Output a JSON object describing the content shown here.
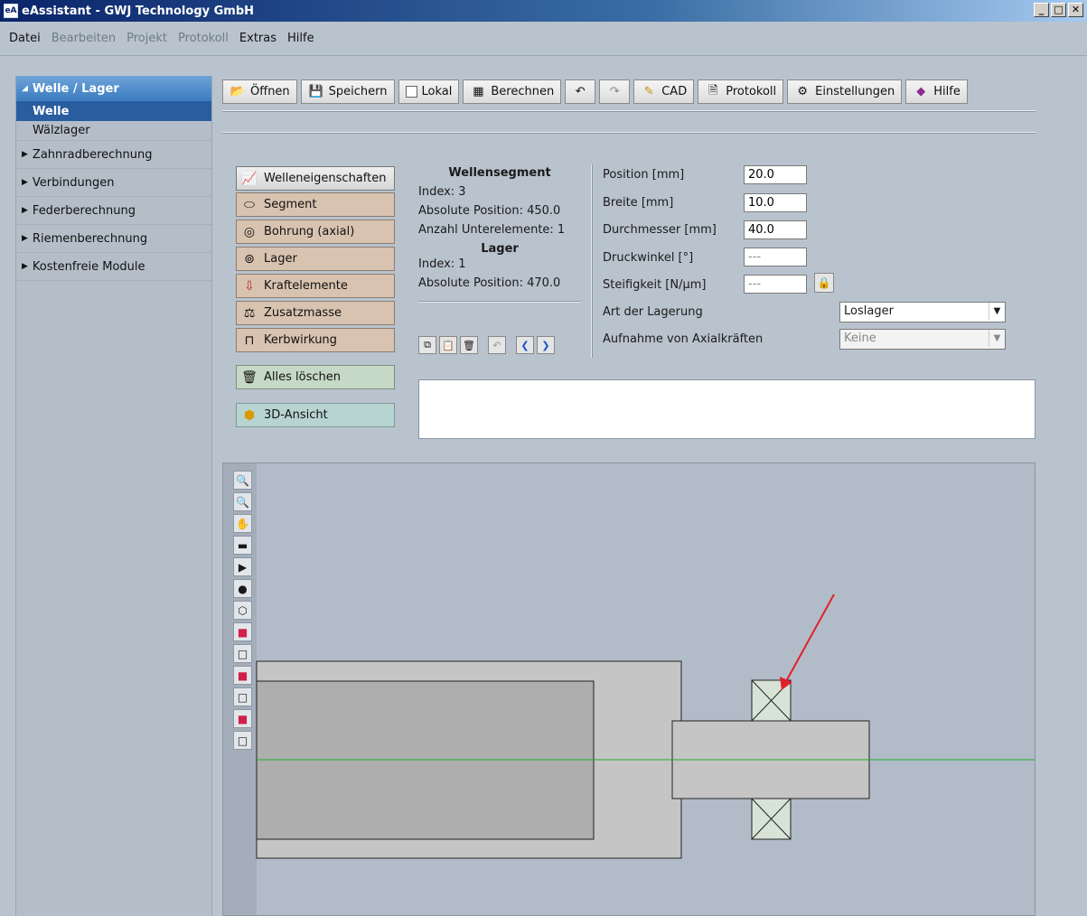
{
  "window": {
    "title": "eAssistant - GWJ Technology GmbH",
    "icon": "eA"
  },
  "menu": [
    {
      "label": "Datei",
      "enabled": true
    },
    {
      "label": "Bearbeiten",
      "enabled": false
    },
    {
      "label": "Projekt",
      "enabled": false
    },
    {
      "label": "Protokoll",
      "enabled": false
    },
    {
      "label": "Extras",
      "enabled": true
    },
    {
      "label": "Hilfe",
      "enabled": true
    }
  ],
  "sidebar": {
    "group": "Welle / Lager",
    "items": [
      "Welle",
      "Wälzlager"
    ],
    "active": "Welle",
    "collapsed": [
      "Zahnradberechnung",
      "Verbindungen",
      "Federberechnung",
      "Riemenberechnung",
      "Kostenfreie Module"
    ]
  },
  "toolbar": {
    "open": "Öffnen",
    "save": "Speichern",
    "local": "Lokal",
    "calculate": "Berechnen",
    "cad": "CAD",
    "protocol": "Protokoll",
    "settings": "Einstellungen",
    "help": "Hilfe"
  },
  "actions": {
    "shaft_properties": "Welleneigenschaften",
    "segment": "Segment",
    "bore": "Bohrung (axial)",
    "bearing": "Lager",
    "forces": "Kraftelemente",
    "mass": "Zusatzmasse",
    "notch": "Kerbwirkung",
    "delete_all": "Alles löschen",
    "view3d": "3D-Ansicht"
  },
  "info": {
    "segment_header": "Wellensegment",
    "segment_index": "Index: 3",
    "segment_position": "Absolute Position:   450.0",
    "segment_subelements": "Anzahl Unterelemente: 1",
    "bearing_header": "Lager",
    "bearing_index": "Index: 1",
    "bearing_position": "Absolute Position:   470.0"
  },
  "params": {
    "position_label": "Position [mm]",
    "position_value": "20.0",
    "width_label": "Breite [mm]",
    "width_value": "10.0",
    "diameter_label": "Durchmesser [mm]",
    "diameter_value": "40.0",
    "pressure_angle_label": "Druckwinkel [°]",
    "pressure_angle_value": "---",
    "stiffness_label": "Steifigkeit [N/µm]",
    "stiffness_value": "---",
    "bearing_type_label": "Art der Lagerung",
    "bearing_type_value": "Loslager",
    "axial_label": "Aufnahme von Axialkräften",
    "axial_value": "Keine"
  },
  "colors": {
    "centerline": "#1fae2c",
    "shaft_fill": "#c5c5c5",
    "bearing_fill": "#d6e3d6",
    "arrow": "#e0202a"
  }
}
